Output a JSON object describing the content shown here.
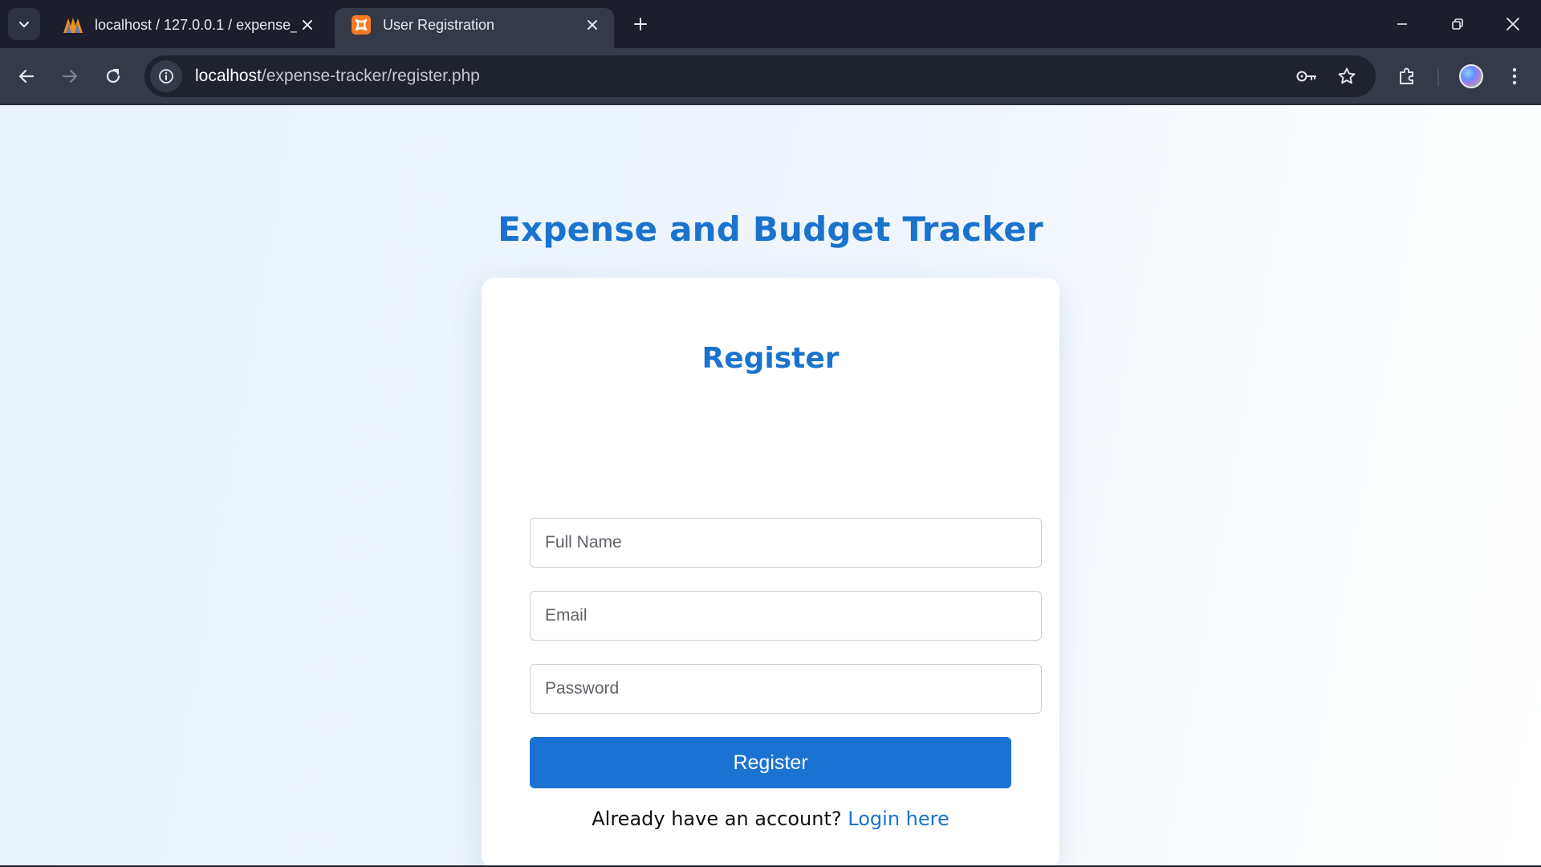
{
  "browser": {
    "tabs": [
      {
        "title": "localhost / 127.0.0.1 / expense_",
        "favicon": "phpmyadmin-icon",
        "active": false
      },
      {
        "title": "User Registration",
        "favicon": "xampp-icon",
        "active": true
      }
    ],
    "address_bar": {
      "host": "localhost",
      "path": "/expense-tracker/register.php"
    }
  },
  "page": {
    "app_title": "Expense and Budget Tracker",
    "form": {
      "title": "Register",
      "full_name_placeholder": "Full Name",
      "email_placeholder": "Email",
      "password_placeholder": "Password",
      "submit_label": "Register"
    },
    "login_prompt": {
      "text": "Already have an account?",
      "link": "Login here"
    }
  },
  "colors": {
    "accent": "#1a73cc",
    "button": "#1a73d2",
    "chrome_dark": "#1c1f2b",
    "chrome_toolbar": "#343a47"
  }
}
